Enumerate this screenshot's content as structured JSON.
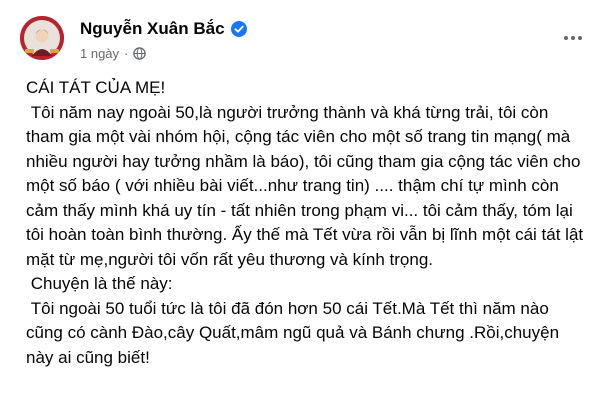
{
  "author": {
    "name": "Nguyễn Xuân Bắc",
    "verified": true,
    "avatar_colors": {
      "ring": "#b8232d",
      "face": "#f0d2b8",
      "background": "#e9e2dc"
    }
  },
  "meta": {
    "time": "1 ngày",
    "separator": "·",
    "audience_icon": "globe-icon"
  },
  "menu_icon": "more-horizontal-icon",
  "colors": {
    "verified_badge": "#1877f2",
    "secondary_text": "#65676b",
    "primary_text": "#050505"
  },
  "post": {
    "paragraphs": [
      "CÁI TÁT CỦA MẸ!",
      " Tôi năm nay ngoài 50,là người trưởng thành và khá từng trải, tôi còn tham gia một vài nhóm hội, cộng tác viên cho một số trang tin mạng( mà nhiều người hay tưởng nhầm là báo), tôi cũng tham gia cộng tác viên cho một số báo ( với nhiều bài viết...như trang tin) .... thậm chí tự mình còn cảm thấy mình khá uy tín - tất nhiên trong phạm vi... tôi cảm thấy, tóm lại tôi hoàn toàn bình thường. Ấy thế mà Tết vừa rồi vẫn bị lĩnh một cái tát lật mặt từ mẹ,người tôi vốn rất yêu thương và kính trọng.",
      " Chuyện là thế này:",
      " Tôi ngoài 50 tuổi tức là tôi đã đón hơn 50 cái Tết.Mà Tết thì năm nào cũng có cành Đào,cây Quất,mâm ngũ quả và Bánh chưng .Rồi,chuyện này ai cũng biết!"
    ]
  }
}
